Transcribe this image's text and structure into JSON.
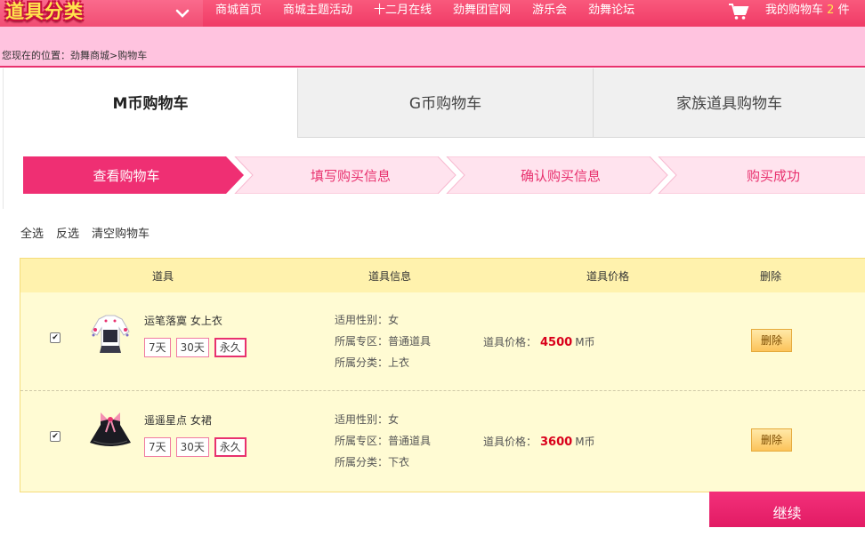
{
  "header": {
    "brand": "道具分类",
    "nav": [
      "商城首页",
      "商城主题活动",
      "十二月在线",
      "劲舞团官网",
      "游乐会",
      "劲舞论坛"
    ],
    "cart_label": "我的购物车",
    "cart_count": "2",
    "cart_unit": "件"
  },
  "breadcrumb": "您现在的位置：劲舞商城>购物车",
  "currency_tabs": [
    "M币购物车",
    "G币购物车",
    "家族道具购物车"
  ],
  "steps": [
    "查看购物车",
    "填写购买信息",
    "确认购买信息",
    "购买成功"
  ],
  "actions": [
    "全选",
    "反选",
    "清空购物车"
  ],
  "table": {
    "headers": [
      "道具",
      "道具信息",
      "道具价格",
      "删除"
    ],
    "rows": [
      {
        "name": "运笔落寞 女上衣",
        "durations": [
          "7天",
          "30天",
          "永久"
        ],
        "selected_duration": "永久",
        "gender": "适用性别：女",
        "zone": "所属专区：普通道具",
        "category": "所属分类：上衣",
        "price_label": "道具价格：",
        "price": "4500",
        "price_unit": "M币",
        "delete_label": "删除",
        "checked": true
      },
      {
        "name": "遥遥星点 女裙",
        "durations": [
          "7天",
          "30天",
          "永久"
        ],
        "selected_duration": "永久",
        "gender": "适用性别：女",
        "zone": "所属专区：普通道具",
        "category": "所属分类：下衣",
        "price_label": "道具价格：",
        "price": "3600",
        "price_unit": "M币",
        "delete_label": "删除",
        "checked": true
      }
    ]
  },
  "continue_label": "继续",
  "colors": {
    "accent": "#e8316e",
    "nav": "#f03b66",
    "crumb_bg": "#ffc3df",
    "row_bg": "#fffbd3",
    "price": "#d9001b"
  }
}
